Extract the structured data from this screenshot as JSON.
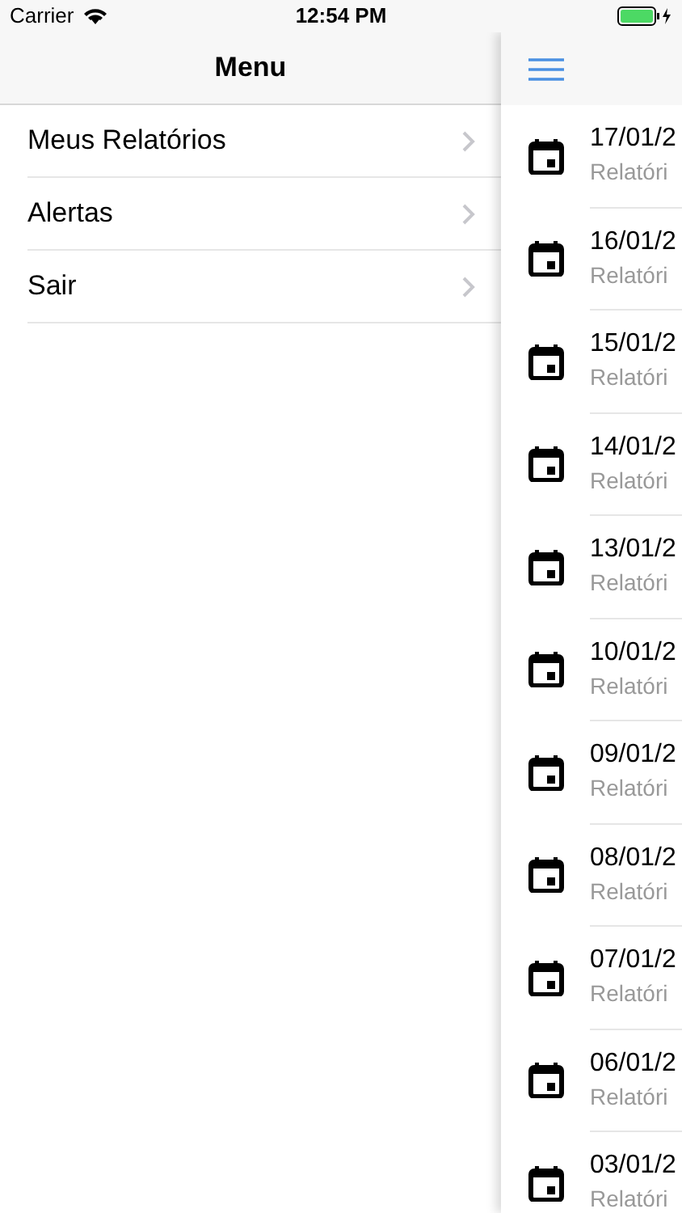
{
  "status_bar": {
    "carrier": "Carrier",
    "time": "12:54 PM"
  },
  "menu": {
    "title": "Menu",
    "items": [
      {
        "label": "Meus Relatórios"
      },
      {
        "label": "Alertas"
      },
      {
        "label": "Sair"
      }
    ]
  },
  "reports": [
    {
      "date": "17/01/2",
      "subtitle": "Relatóri"
    },
    {
      "date": "16/01/2",
      "subtitle": "Relatóri"
    },
    {
      "date": "15/01/2",
      "subtitle": "Relatóri"
    },
    {
      "date": "14/01/2",
      "subtitle": "Relatóri"
    },
    {
      "date": "13/01/2",
      "subtitle": "Relatóri"
    },
    {
      "date": "10/01/2",
      "subtitle": "Relatóri"
    },
    {
      "date": "09/01/2",
      "subtitle": "Relatóri"
    },
    {
      "date": "08/01/2",
      "subtitle": "Relatóri"
    },
    {
      "date": "07/01/2",
      "subtitle": "Relatóri"
    },
    {
      "date": "06/01/2",
      "subtitle": "Relatóri"
    },
    {
      "date": "03/01/2",
      "subtitle": "Relatóri"
    }
  ]
}
